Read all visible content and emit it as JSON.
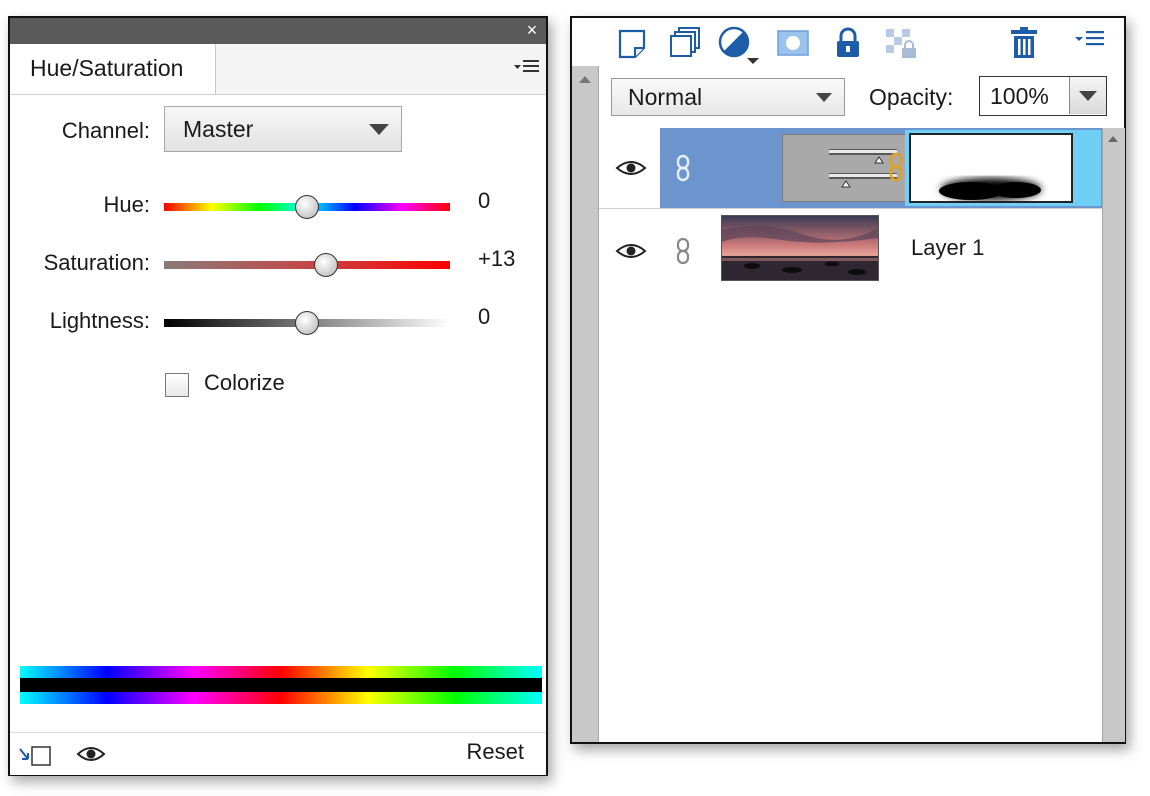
{
  "hue_saturation": {
    "close_glyph": "×",
    "tab_label": "Hue/Saturation",
    "channel_label": "Channel:",
    "channel_value": "Master",
    "hue": {
      "label": "Hue:",
      "value": "0",
      "level": 0.5
    },
    "saturation": {
      "label": "Saturation:",
      "value": "+13",
      "level": 0.565
    },
    "lightness": {
      "label": "Lightness:",
      "value": "0",
      "level": 0.5
    },
    "colorize_label": "Colorize",
    "colorize_checked": false,
    "reset_label": "Reset"
  },
  "layers": {
    "blend_mode": "Normal",
    "opacity_label": "Opacity:",
    "opacity_value": "100%",
    "rows": [
      {
        "type": "adjustment",
        "selected": true,
        "visible": true,
        "name": ""
      },
      {
        "type": "image",
        "selected": false,
        "visible": true,
        "name": "Layer 1"
      }
    ]
  },
  "colors": {
    "selection": "#6b95cc",
    "mask_highlight": "#6fcff4",
    "link_active": "#e0a020",
    "toolbar_icon": "#1d5da8"
  },
  "icons": [
    "close-icon",
    "panel-menu-icon",
    "chevron-down-icon",
    "clip-to-layer-icon",
    "eye-icon",
    "new-layer-icon",
    "new-group-icon",
    "adjustment-layer-icon",
    "add-mask-icon",
    "lock-icon",
    "lock-transparency-icon",
    "trash-icon",
    "link-icon"
  ]
}
